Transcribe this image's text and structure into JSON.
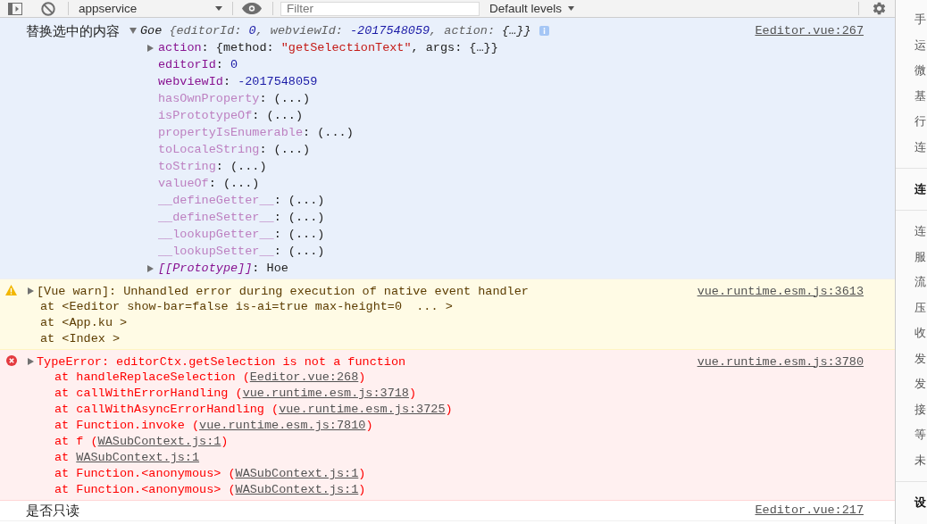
{
  "toolbar": {
    "context": "appservice",
    "filter": {
      "placeholder": "Filter"
    },
    "levels": "Default levels"
  },
  "messages": [
    {
      "kind": "log",
      "selected": true,
      "expanded": true,
      "label": "替换选中的内容",
      "summary": [
        {
          "kind": "text",
          "text": "Goe "
        },
        {
          "kind": "muted",
          "text": "{editorId: "
        },
        {
          "kind": "number",
          "text": "0"
        },
        {
          "kind": "muted",
          "text": ", webviewId: "
        },
        {
          "kind": "number",
          "text": "-2017548059"
        },
        {
          "kind": "muted",
          "text": ", action: "
        },
        {
          "kind": "text",
          "text": "{…}}"
        }
      ],
      "source": "Eeditor.vue:267",
      "properties": [
        {
          "expanded": false,
          "tokens": [
            {
              "kind": "key",
              "text": "action"
            },
            {
              "kind": "text",
              "text": ": {method: "
            },
            {
              "kind": "string",
              "text": "\"getSelectionText\""
            },
            {
              "kind": "text",
              "text": ", args: {…}}"
            }
          ]
        },
        {
          "tokens": [
            {
              "kind": "key",
              "text": "editorId"
            },
            {
              "kind": "text",
              "text": ": "
            },
            {
              "kind": "number",
              "text": "0"
            }
          ]
        },
        {
          "tokens": [
            {
              "kind": "key",
              "text": "webviewId"
            },
            {
              "kind": "text",
              "text": ": "
            },
            {
              "kind": "number",
              "text": "-2017548059"
            }
          ]
        },
        {
          "tokens": [
            {
              "kind": "inherited_key",
              "text": "hasOwnProperty"
            },
            {
              "kind": "text",
              "text": ": (...)"
            }
          ]
        },
        {
          "tokens": [
            {
              "kind": "inherited_key",
              "text": "isPrototypeOf"
            },
            {
              "kind": "text",
              "text": ": (...)"
            }
          ]
        },
        {
          "tokens": [
            {
              "kind": "inherited_key",
              "text": "propertyIsEnumerable"
            },
            {
              "kind": "text",
              "text": ": (...)"
            }
          ]
        },
        {
          "tokens": [
            {
              "kind": "inherited_key",
              "text": "toLocaleString"
            },
            {
              "kind": "text",
              "text": ": (...)"
            }
          ]
        },
        {
          "tokens": [
            {
              "kind": "inherited_key",
              "text": "toString"
            },
            {
              "kind": "text",
              "text": ": (...)"
            }
          ]
        },
        {
          "tokens": [
            {
              "kind": "inherited_key",
              "text": "valueOf"
            },
            {
              "kind": "text",
              "text": ": (...)"
            }
          ]
        },
        {
          "tokens": [
            {
              "kind": "inherited_key",
              "text": "__defineGetter__"
            },
            {
              "kind": "text",
              "text": ": (...)"
            }
          ]
        },
        {
          "tokens": [
            {
              "kind": "inherited_key",
              "text": "__defineSetter__"
            },
            {
              "kind": "text",
              "text": ": (...)"
            }
          ]
        },
        {
          "tokens": [
            {
              "kind": "inherited_key",
              "text": "__lookupGetter__"
            },
            {
              "kind": "text",
              "text": ": (...)"
            }
          ]
        },
        {
          "tokens": [
            {
              "kind": "inherited_key",
              "text": "__lookupSetter__"
            },
            {
              "kind": "text",
              "text": ": (...)"
            }
          ]
        },
        {
          "expanded": false,
          "tokens": [
            {
              "kind": "internal_key",
              "text": "[[Prototype]]"
            },
            {
              "kind": "text",
              "text": ": Hoe"
            }
          ]
        }
      ]
    },
    {
      "kind": "warning",
      "selected": false,
      "expanded": false,
      "text": "[Vue warn]: Unhandled error during execution of native event handler",
      "source": "vue.runtime.esm.js:3613",
      "stack": [
        [
          {
            "kind": "text",
            "text": "at <Eeditor show-bar=false is-ai=true max-height=0  ... >"
          }
        ],
        [
          {
            "kind": "text",
            "text": "at <App.ku >"
          }
        ],
        [
          {
            "kind": "text",
            "text": "at <Index >"
          }
        ]
      ]
    },
    {
      "kind": "error",
      "selected": false,
      "expanded": false,
      "text": "TypeError: editorCtx.getSelection is not a function",
      "source": "vue.runtime.esm.js:3780",
      "stack": [
        [
          {
            "kind": "text",
            "text": "at handleReplaceSelection ("
          },
          {
            "kind": "link",
            "text": "Eeditor.vue:268"
          },
          {
            "kind": "text",
            "text": ")"
          }
        ],
        [
          {
            "kind": "text",
            "text": "at callWithErrorHandling ("
          },
          {
            "kind": "link",
            "text": "vue.runtime.esm.js:3718"
          },
          {
            "kind": "text",
            "text": ")"
          }
        ],
        [
          {
            "kind": "text",
            "text": "at callWithAsyncErrorHandling ("
          },
          {
            "kind": "link",
            "text": "vue.runtime.esm.js:3725"
          },
          {
            "kind": "text",
            "text": ")"
          }
        ],
        [
          {
            "kind": "text",
            "text": "at Function.invoke ("
          },
          {
            "kind": "link",
            "text": "vue.runtime.esm.js:7810"
          },
          {
            "kind": "text",
            "text": ")"
          }
        ],
        [
          {
            "kind": "text",
            "text": "at f ("
          },
          {
            "kind": "link",
            "text": "WASubContext.js:1"
          },
          {
            "kind": "text",
            "text": ")"
          }
        ],
        [
          {
            "kind": "text",
            "text": "at "
          },
          {
            "kind": "link",
            "text": "WASubContext.js:1"
          }
        ],
        [
          {
            "kind": "text",
            "text": "at Function.<anonymous> ("
          },
          {
            "kind": "link",
            "text": "WASubContext.js:1"
          },
          {
            "kind": "text",
            "text": ")"
          }
        ],
        [
          {
            "kind": "text",
            "text": "at Function.<anonymous> ("
          },
          {
            "kind": "link",
            "text": "WASubContext.js:1"
          },
          {
            "kind": "text",
            "text": ")"
          }
        ]
      ]
    },
    {
      "kind": "log",
      "selected": false,
      "label": "是否只读",
      "source": "Eeditor.vue:217"
    }
  ],
  "sidebar": {
    "groups": [
      {
        "items": [
          "手",
          "运",
          "微",
          "基",
          "行",
          "连"
        ]
      },
      {
        "title": "连",
        "items": [
          "连",
          "服",
          "流",
          "压",
          "收",
          "发",
          "发",
          "接",
          "等",
          "未"
        ]
      },
      {
        "title": "设"
      }
    ]
  }
}
